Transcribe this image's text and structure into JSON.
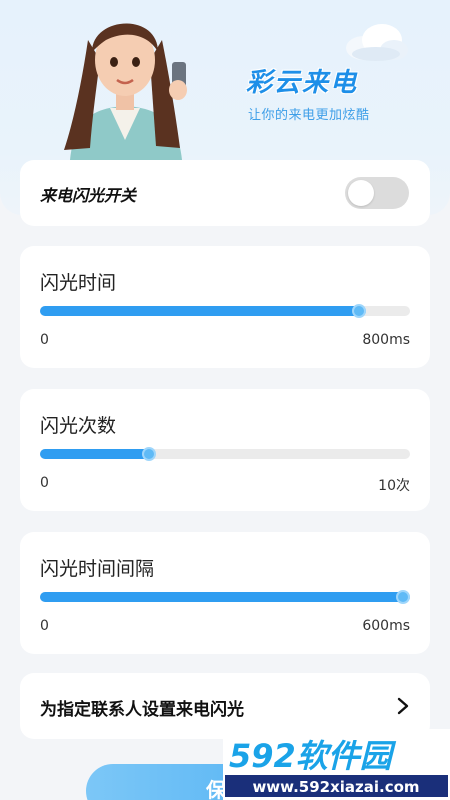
{
  "brand": {
    "title": "彩云来电",
    "subtitle": "让你的来电更加炫酷"
  },
  "flash_switch": {
    "label": "来电闪光开关",
    "enabled": false
  },
  "sliders": [
    {
      "title": "闪光时间",
      "min_label": "0",
      "max_label": "800ms",
      "fraction": 0.88
    },
    {
      "title": "闪光次数",
      "min_label": "0",
      "max_label": "10次",
      "fraction": 0.3
    },
    {
      "title": "闪光时间间隔",
      "min_label": "0",
      "max_label": "600ms",
      "fraction": 1.0
    }
  ],
  "contact_setting": {
    "label": "为指定联系人设置来电闪光"
  },
  "save_button": {
    "label": "保存"
  },
  "watermark": {
    "brand": "592软件园",
    "url": "www.592xiazai.com"
  },
  "colors": {
    "accent": "#2f9df1",
    "switch_off": "#dcdcdc",
    "background": "#f3f5f8"
  },
  "icons": {
    "contact_arrow": "chevron-right-icon",
    "cloud": "cloud-icon",
    "avatar": "avatar-illustration"
  }
}
